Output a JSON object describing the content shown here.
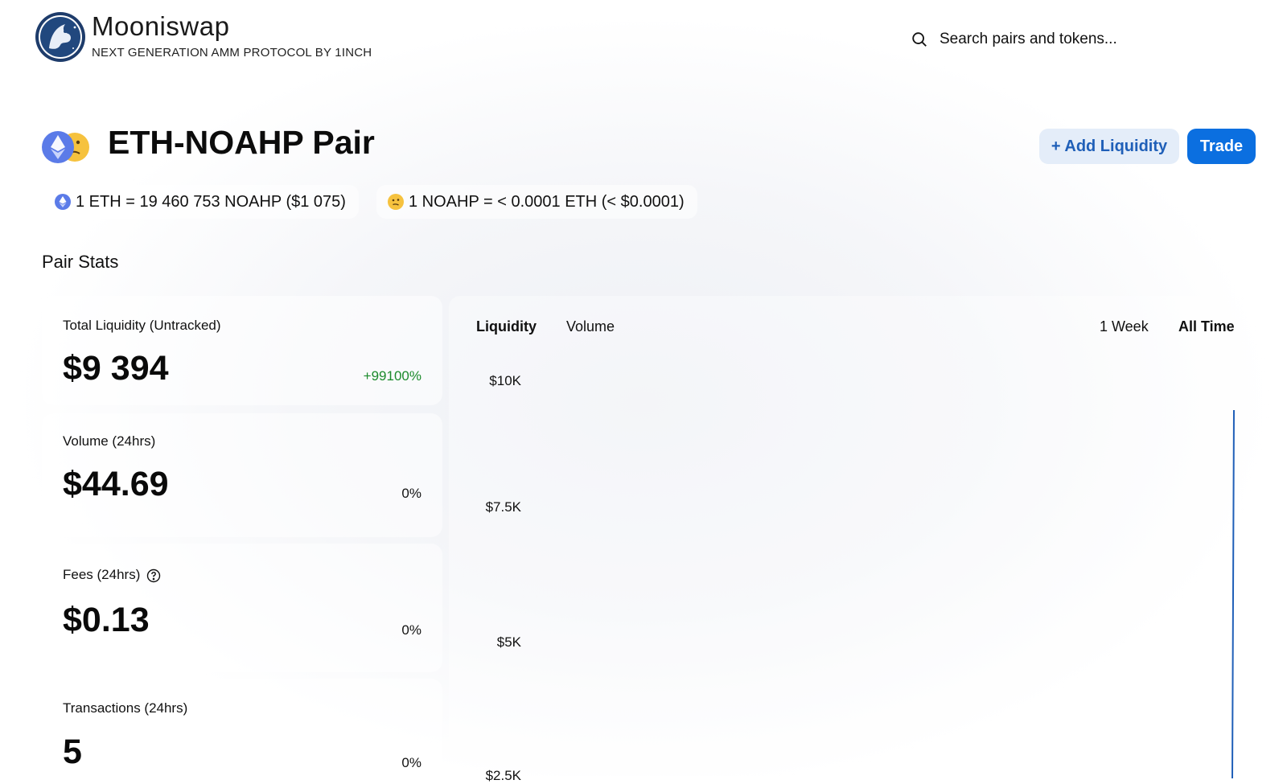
{
  "header": {
    "brand_name": "Mooniswap",
    "brand_tagline": "NEXT GENERATION AMM PROTOCOL BY 1INCH",
    "search_placeholder": "Search pairs and tokens..."
  },
  "pair": {
    "title": "ETH-NOAHP Pair",
    "add_liquidity_label": "+ Add Liquidity",
    "trade_label": "Trade",
    "rate_eth": "1 ETH = 19 460 753 NOAHP ($1 075)",
    "rate_noahp": "1 NOAHP = < 0.0001 ETH (< $0.0001)"
  },
  "stats": {
    "section_title": "Pair Stats",
    "items": [
      {
        "label": "Total Liquidity (Untracked)",
        "value": "$9 394",
        "change": "+99100%"
      },
      {
        "label": "Volume (24hrs)",
        "value": "$44.69",
        "change": "0%"
      },
      {
        "label": "Fees (24hrs)",
        "value": "$0.13",
        "change": "0%"
      },
      {
        "label": "Transactions (24hrs)",
        "value": "5",
        "change": "0%"
      }
    ]
  },
  "chart": {
    "tabs": [
      "Liquidity",
      "Volume"
    ],
    "active_tab": "Liquidity",
    "ranges": [
      "1 Week",
      "All Time"
    ],
    "active_range": "All Time",
    "y_ticks": [
      "$10K",
      "$7.5K",
      "$5K",
      "$2.5K"
    ],
    "line_color": "#1f5fb8"
  },
  "colors": {
    "accent": "#0b6fe0",
    "positive": "#1b8a2b"
  }
}
